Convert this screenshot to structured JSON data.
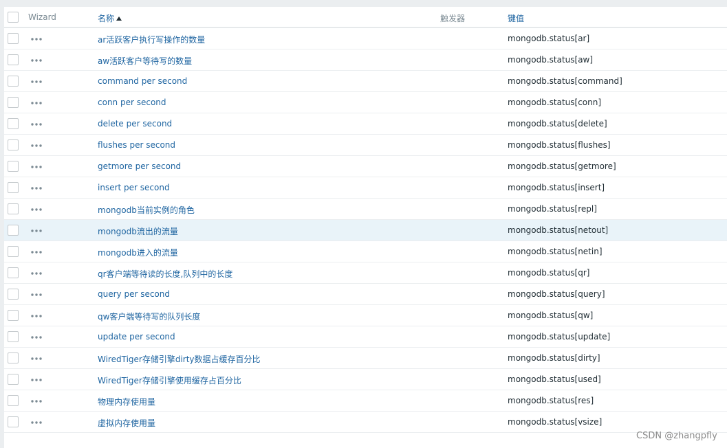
{
  "header": {
    "wizard": "Wizard",
    "name": "名称",
    "trigger": "触发器",
    "key": "键值"
  },
  "highlighted_row_index": 9,
  "rows": [
    {
      "name": "ar活跃客户执行写操作的数量",
      "key": "mongodb.status[ar]"
    },
    {
      "name": "aw活跃客户等待写的数量",
      "key": "mongodb.status[aw]"
    },
    {
      "name": "command per second",
      "key": "mongodb.status[command]"
    },
    {
      "name": "conn per second",
      "key": "mongodb.status[conn]"
    },
    {
      "name": "delete per second",
      "key": "mongodb.status[delete]"
    },
    {
      "name": "flushes per second",
      "key": "mongodb.status[flushes]"
    },
    {
      "name": "getmore per second",
      "key": "mongodb.status[getmore]"
    },
    {
      "name": "insert per second",
      "key": "mongodb.status[insert]"
    },
    {
      "name": "mongodb当前实例的角色",
      "key": "mongodb.status[repl]"
    },
    {
      "name": "mongodb流出的流量",
      "key": "mongodb.status[netout]"
    },
    {
      "name": "mongodb进入的流量",
      "key": "mongodb.status[netin]"
    },
    {
      "name": "qr客户端等待读的长度,队列中的长度",
      "key": "mongodb.status[qr]"
    },
    {
      "name": "query per second",
      "key": "mongodb.status[query]"
    },
    {
      "name": "qw客户端等待写的队列长度",
      "key": "mongodb.status[qw]"
    },
    {
      "name": "update per second",
      "key": "mongodb.status[update]"
    },
    {
      "name": "WiredTiger存储引擎dirty数据占缓存百分比",
      "key": "mongodb.status[dirty]"
    },
    {
      "name": "WiredTiger存储引擎使用缓存占百分比",
      "key": "mongodb.status[used]"
    },
    {
      "name": "物理内存使用量",
      "key": "mongodb.status[res]"
    },
    {
      "name": "虚拟内存使用量",
      "key": "mongodb.status[vsize]"
    }
  ],
  "watermark": "CSDN @zhangpfly",
  "colors": {
    "link": "#1f65a1",
    "highlight": "#e9f3f9",
    "text": "#1f2c33"
  }
}
